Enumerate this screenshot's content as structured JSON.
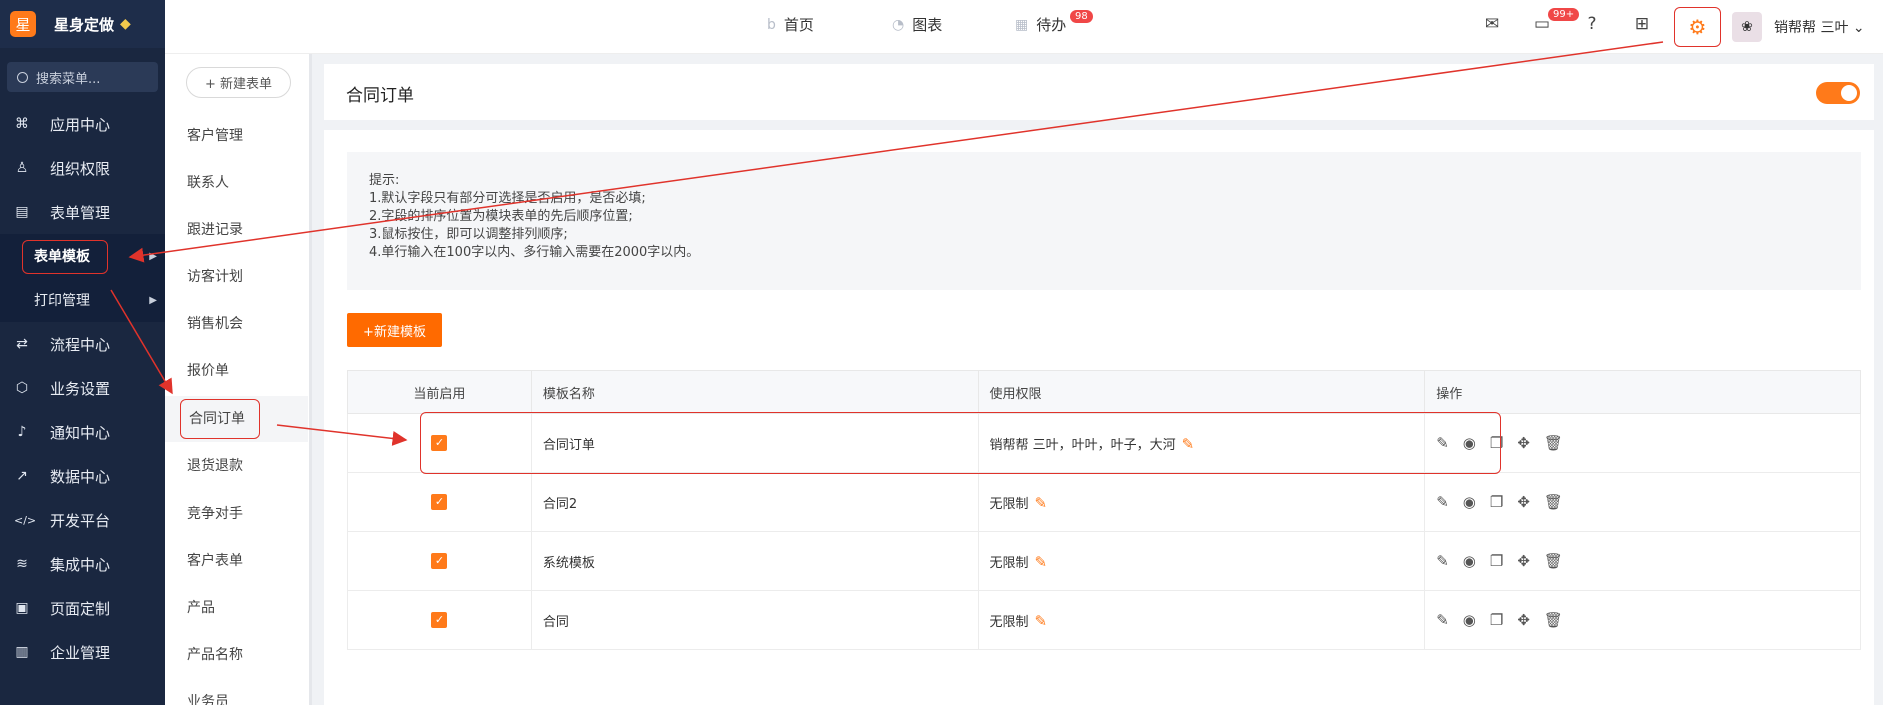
{
  "nav": {
    "brand_logo": "星",
    "brand_name": "星身定做",
    "search_placeholder": "搜索菜单...",
    "items": [
      {
        "label": "应用中心",
        "icon": "⌘"
      },
      {
        "label": "组织权限",
        "icon": "♙"
      },
      {
        "label": "表单管理",
        "icon": "▤"
      }
    ],
    "sub_items": [
      {
        "label": "表单模板"
      },
      {
        "label": "打印管理"
      }
    ],
    "items2": [
      {
        "label": "流程中心",
        "icon": "⇄"
      },
      {
        "label": "业务设置",
        "icon": "⬡"
      },
      {
        "label": "通知中心",
        "icon": "♪"
      },
      {
        "label": "数据中心",
        "icon": "↗"
      },
      {
        "label": "开发平台",
        "icon": "</>"
      },
      {
        "label": "集成中心",
        "icon": "≋"
      },
      {
        "label": "页面定制",
        "icon": "▣"
      },
      {
        "label": "企业管理",
        "icon": "▥"
      }
    ]
  },
  "topbar": {
    "tabs": [
      {
        "label": "首页",
        "icon": "b"
      },
      {
        "label": "图表",
        "icon": "◔"
      },
      {
        "label": "待办",
        "icon": "▦",
        "badge": "98"
      }
    ],
    "chat_badge": "99+",
    "user_name": "销帮帮 三叶"
  },
  "side": {
    "new_form": "+ 新建表单",
    "items": [
      "客户管理",
      "联系人",
      "跟进记录",
      "访客计划",
      "销售机会",
      "报价单",
      "合同订单",
      "退货退款",
      "竞争对手",
      "客户表单",
      "产品",
      "产品名称",
      "业务员"
    ]
  },
  "main": {
    "title": "合同订单",
    "tips": [
      "提示:",
      "1.默认字段只有部分可选择是否启用，是否必填;",
      "2.字段的排序位置为模块表单的先后顺序位置;",
      "3.鼠标按住，即可以调整排列顺序;",
      "4.单行输入在100字以内、多行输入需要在2000字以内。"
    ],
    "new_template": "+新建模板",
    "columns": [
      "当前启用",
      "模板名称",
      "使用权限",
      "操作"
    ],
    "rows": [
      {
        "name": "合同订单",
        "permission": "销帮帮 三叶，叶叶，叶子，大河"
      },
      {
        "name": "合同2",
        "permission": "无限制"
      },
      {
        "name": "系统模板",
        "permission": "无限制"
      },
      {
        "name": "合同",
        "permission": "无限制"
      }
    ]
  }
}
